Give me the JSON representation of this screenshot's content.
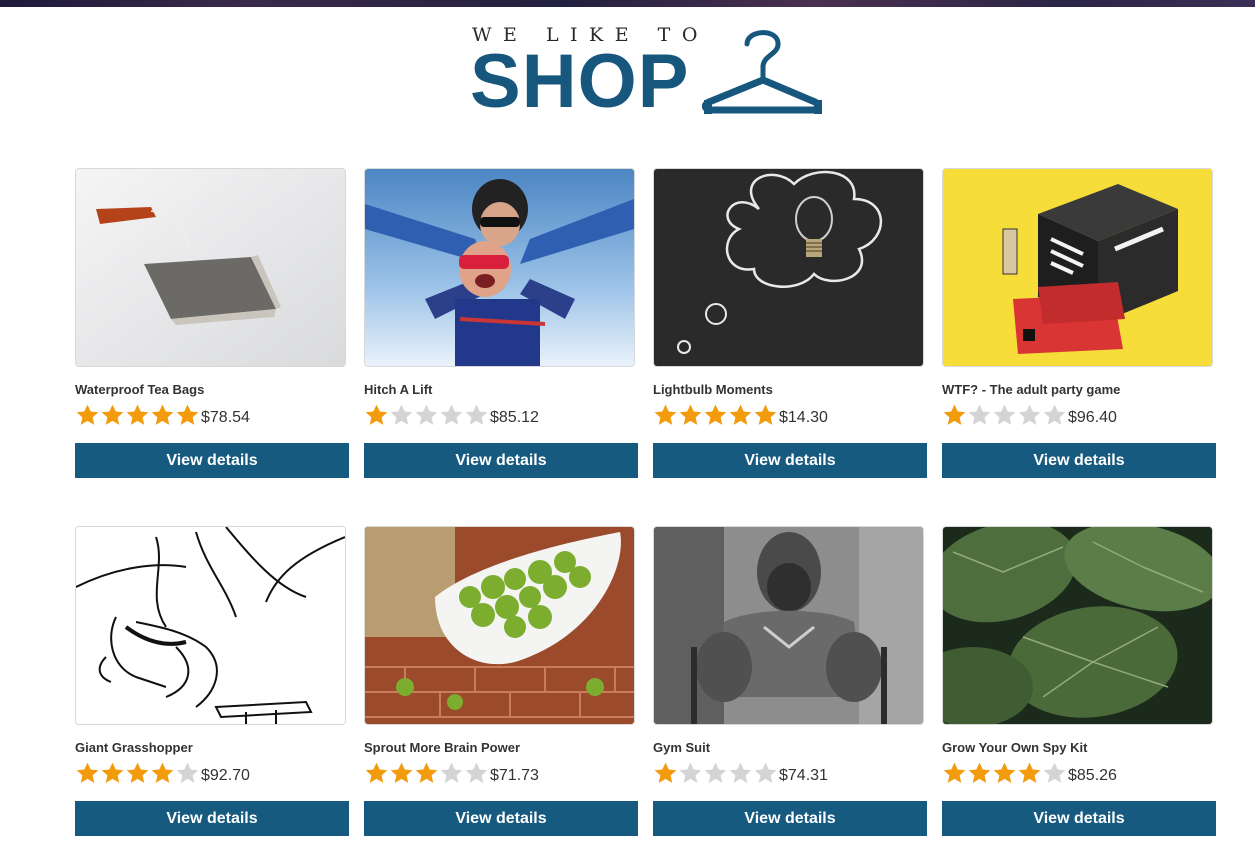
{
  "header": {
    "logo_small": "WE LIKE TO",
    "logo_big": "SHOP"
  },
  "colors": {
    "brand": "#17577e",
    "button": "#165a80",
    "star_on": "#f29b0c",
    "star_off": "#d4d4d4"
  },
  "products": [
    {
      "name": "Waterproof Tea Bags",
      "rating": 5,
      "price": "$78.54",
      "button": "View details"
    },
    {
      "name": "Hitch A Lift",
      "rating": 1,
      "price": "$85.12",
      "button": "View details"
    },
    {
      "name": "Lightbulb Moments",
      "rating": 5,
      "price": "$14.30",
      "button": "View details"
    },
    {
      "name": "WTF? - The adult party game",
      "rating": 1,
      "price": "$96.40",
      "button": "View details"
    },
    {
      "name": "Giant Grasshopper",
      "rating": 4,
      "price": "$92.70",
      "button": "View details"
    },
    {
      "name": "Sprout More Brain Power",
      "rating": 3,
      "price": "$71.73",
      "button": "View details"
    },
    {
      "name": "Gym Suit",
      "rating": 1,
      "price": "$74.31",
      "button": "View details"
    },
    {
      "name": "Grow Your Own Spy Kit",
      "rating": 4,
      "price": "$85.26",
      "button": "View details"
    }
  ]
}
